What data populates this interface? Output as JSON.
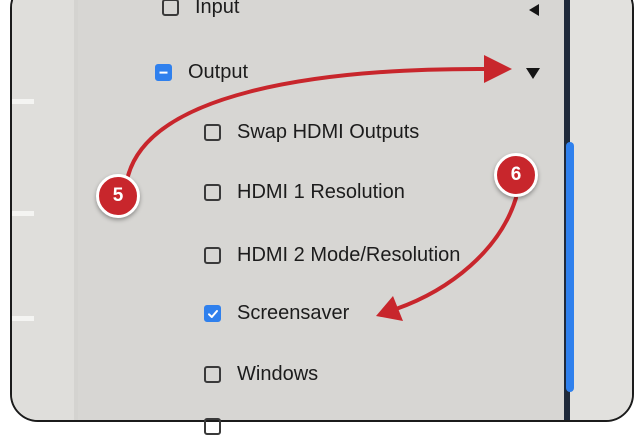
{
  "settings": {
    "input": {
      "label": "Input",
      "state": "unchecked"
    },
    "output": {
      "label": "Output",
      "state": "indeterminate",
      "toggle_icon": "triangle-down-icon"
    },
    "items": [
      {
        "label": "Swap HDMI Outputs",
        "checked": false
      },
      {
        "label": "HDMI 1 Resolution",
        "checked": false
      },
      {
        "label": "HDMI 2 Mode/Resolution",
        "checked": false
      },
      {
        "label": "Screensaver",
        "checked": true
      },
      {
        "label": "Windows",
        "checked": false
      }
    ]
  },
  "annotations": [
    {
      "number": "5",
      "color": "#c8262c"
    },
    {
      "number": "6",
      "color": "#c8262c"
    }
  ],
  "colors": {
    "accent": "#2f80ed",
    "annotation": "#c8262c",
    "panel": "#d7d6d3"
  }
}
